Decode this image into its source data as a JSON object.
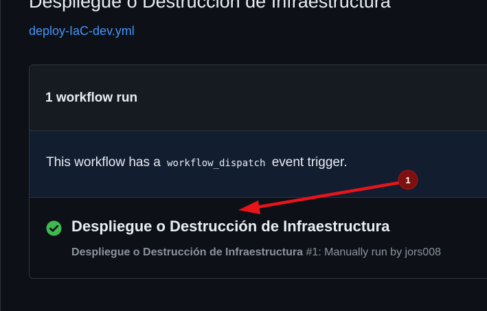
{
  "page": {
    "title": "Despliegue o Destrucción de Infraestructura",
    "workflow_file": "deploy-IaC-dev.yml"
  },
  "runs": {
    "count_label": "1 workflow run",
    "dispatch_prefix": "This workflow has a",
    "dispatch_code": "workflow_dispatch",
    "dispatch_suffix": "event trigger.",
    "items": [
      {
        "status": "success",
        "title": "Despliegue o Destrucción de Infraestructura",
        "workflow_name": "Despliegue o Destrucción de Infraestructura",
        "run_number": "#1",
        "trigger_text": ": Manually run by jors008"
      }
    ]
  },
  "annotation": {
    "badge_number": "1",
    "badge_color": "#7f1010",
    "arrow_color": "#e8141b"
  },
  "colors": {
    "background": "#0d1117",
    "link": "#4493f8",
    "success": "#3fb950",
    "muted_text": "#8b949e"
  },
  "icons": {
    "status": "check-circle-fill-icon"
  }
}
